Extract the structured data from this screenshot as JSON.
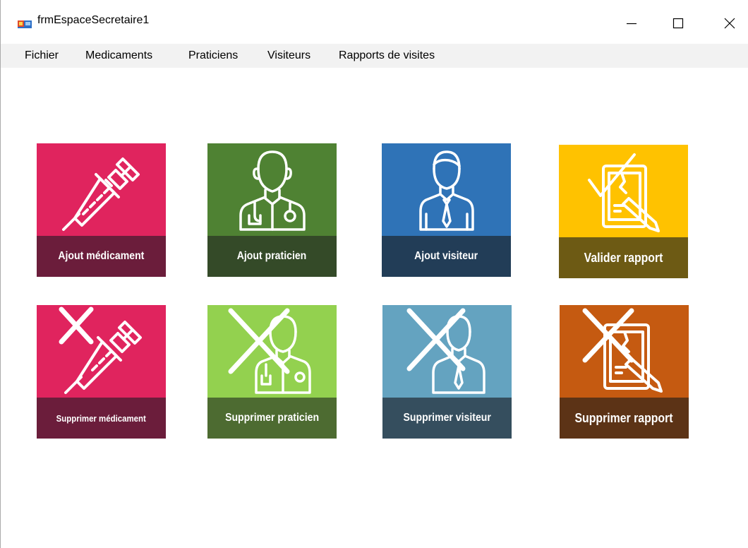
{
  "window": {
    "title": "frmEspaceSecretaire1",
    "controls": [
      "minimize-icon",
      "maximize-icon",
      "close-icon"
    ]
  },
  "menu": {
    "items": [
      "Fichier",
      "Medicaments",
      "Praticiens",
      "Visiteurs",
      "Rapports de visites"
    ]
  },
  "tiles": {
    "ajout_medicament": {
      "label": "Ajout médicament",
      "icon": "syringe-icon",
      "color": "#e0245e",
      "band_color": "#6b1d3b"
    },
    "ajout_praticien": {
      "label": "Ajout praticien",
      "icon": "doctor-icon",
      "color": "#4f8233",
      "band_color": "#344a28"
    },
    "ajout_visiteur": {
      "label": "Ajout visiteur",
      "icon": "businessman-icon",
      "color": "#2f73b7",
      "band_color": "#223d57"
    },
    "valider_rapport": {
      "label": "Valider rapport",
      "icon": "report-check-icon",
      "color": "#ffc200",
      "band_color": "#6d5a14"
    },
    "supprimer_medicament": {
      "label": "Supprimer médicament",
      "icon": "syringe-delete-icon",
      "color": "#e0245e",
      "band_color": "#6b1d3b"
    },
    "supprimer_praticien": {
      "label": "Supprimer praticien",
      "icon": "doctor-delete-icon",
      "color": "#93d14f",
      "band_color": "#4d6b31"
    },
    "supprimer_visiteur": {
      "label": "Supprimer visiteur",
      "icon": "businessman-delete-icon",
      "color": "#64a3c0",
      "band_color": "#354e5e"
    },
    "supprimer_rapport": {
      "label": "Supprimer rapport",
      "icon": "report-delete-icon",
      "color": "#c55a11",
      "band_color": "#5c3316"
    }
  }
}
